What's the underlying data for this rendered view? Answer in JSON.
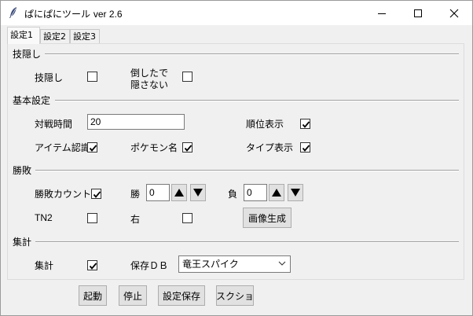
{
  "window": {
    "title_prefix": "ぱにぱにツール",
    "title_version": "ver 2.6"
  },
  "tabs": [
    {
      "label": "設定1",
      "active": true
    },
    {
      "label": "設定2",
      "active": false
    },
    {
      "label": "設定3",
      "active": false
    }
  ],
  "sections": {
    "hide": {
      "title": "技隠し",
      "hide_label": "技隠し",
      "hide_checked": false,
      "not_hide_line1": "倒したで",
      "not_hide_line2": "隠さない",
      "not_hide_checked": false
    },
    "basic": {
      "title": "基本設定",
      "battle_time_label": "対戦時間",
      "battle_time_value": "20",
      "rank_label": "順位表示",
      "rank_checked": true,
      "item_label": "アイテム認識",
      "item_checked": true,
      "pokemon_label": "ポケモン名",
      "pokemon_checked": true,
      "type_label": "タイプ表示",
      "type_checked": true
    },
    "winloss": {
      "title": "勝敗",
      "count_label": "勝敗カウント",
      "count_checked": true,
      "win_label": "勝",
      "win_value": "0",
      "loss_label": "負",
      "loss_value": "0",
      "tn2_label": "TN2",
      "tn2_checked": false,
      "right_label": "右",
      "right_checked": false,
      "image_button": "画像生成"
    },
    "tally": {
      "title": "集計",
      "tally_label": "集計",
      "tally_checked": true,
      "db_label": "保存ＤＢ",
      "db_value": "竜王スパイク"
    }
  },
  "bottom_buttons": {
    "start": "起動",
    "stop": "停止",
    "save": "設定保存",
    "screenshot": "スクショ"
  },
  "icons": [
    "feather-icon",
    "minimize-icon",
    "maximize-icon",
    "close-icon",
    "up-arrow-icon",
    "down-arrow-icon",
    "chevron-down-icon",
    "checkmark-icon"
  ]
}
